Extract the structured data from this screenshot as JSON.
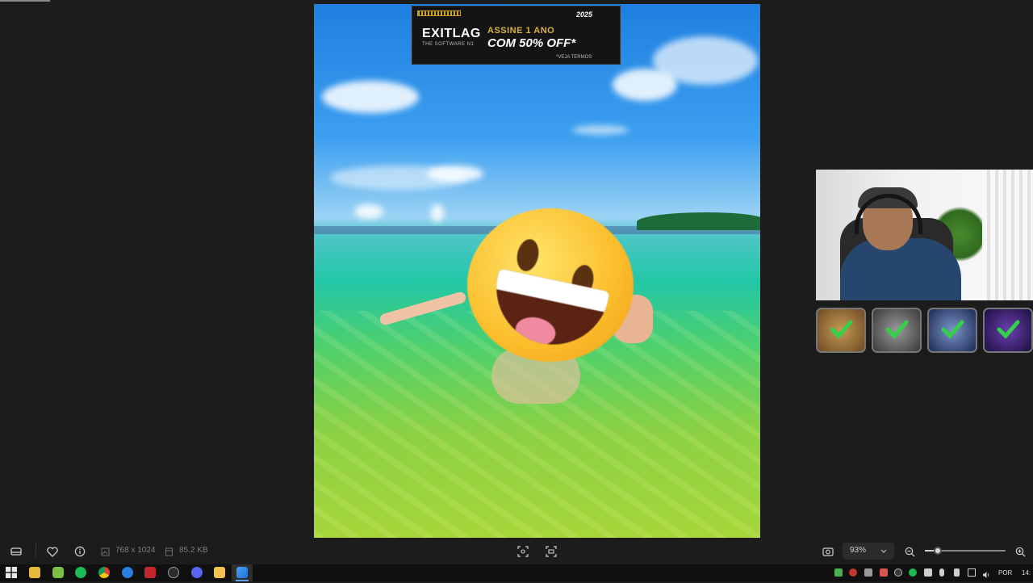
{
  "ad_banner": {
    "brand": "EXITLAG",
    "tagline": "THE SOFTWARE N1",
    "offer_line1": "ASSINE 1 ANO",
    "offer_line2": "COM 50% OFF*",
    "terms": "*VEJA TERMOS",
    "year": "2025"
  },
  "viewer_toolbar": {
    "dimensions": "768 x 1024",
    "file_size": "85.2 KB",
    "zoom_level": "93%",
    "zoom_slider_percent": 16
  },
  "overlay": {
    "achievements": [
      {
        "name": "achievement-badge-cracked-earth",
        "completed": true
      },
      {
        "name": "achievement-badge-storm",
        "completed": true
      },
      {
        "name": "achievement-badge-lightning",
        "completed": true
      },
      {
        "name": "achievement-badge-galaxy",
        "completed": true
      }
    ]
  },
  "taskbar": {
    "apps": [
      "windows-start-icon",
      "file-explorer-icon",
      "android-app-icon",
      "spotify-icon",
      "chrome-icon",
      "media-player-icon",
      "news-app-icon",
      "steam-icon",
      "discord-icon",
      "folder-icon",
      "photos-app-icon"
    ],
    "language": "POR",
    "time": "14:"
  },
  "colors": {
    "accent": "#5aa0ff",
    "check_green": "#35d04a",
    "viewer_bg": "#1c1c1c"
  }
}
